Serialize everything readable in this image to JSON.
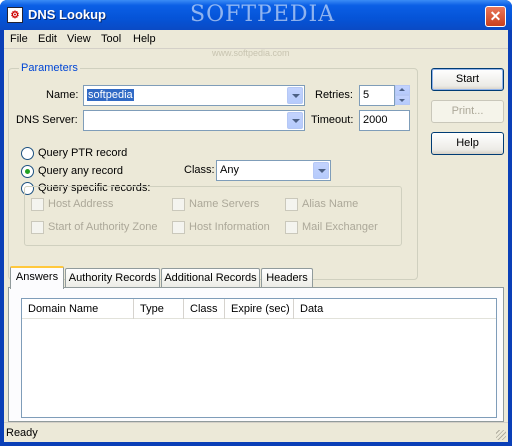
{
  "window": {
    "title": "DNS Lookup",
    "watermark": "SOFTPEDIA",
    "watermark_url": "www.softpedia.com",
    "close": "✕"
  },
  "menu": [
    "File",
    "Edit",
    "View",
    "Tool",
    "Help"
  ],
  "parameters": {
    "title": "Parameters",
    "name_label": "Name:",
    "name_value": "softpedia",
    "dns_label": "DNS Server:",
    "dns_value": "",
    "retries_label": "Retries:",
    "retries_value": "5",
    "timeout_label": "Timeout:",
    "timeout_value": "2000",
    "radios": [
      {
        "label": "Query PTR record",
        "checked": false
      },
      {
        "label": "Query any record",
        "checked": true
      },
      {
        "label": "Query specific records:",
        "checked": false
      }
    ],
    "class_label": "Class:",
    "class_value": "Any",
    "records": [
      "Host Address",
      "Name Servers",
      "Alias Name",
      "Start of Authority Zone",
      "Host Information",
      "Mail Exchanger"
    ]
  },
  "buttons": {
    "start": "Start",
    "print": "Print...",
    "help": "Help"
  },
  "tabs": [
    "Answers",
    "Authority Records",
    "Additional Records",
    "Headers"
  ],
  "columns": [
    "Domain Name",
    "Type",
    "Class",
    "Expire (sec)",
    "Data"
  ],
  "status": "Ready"
}
